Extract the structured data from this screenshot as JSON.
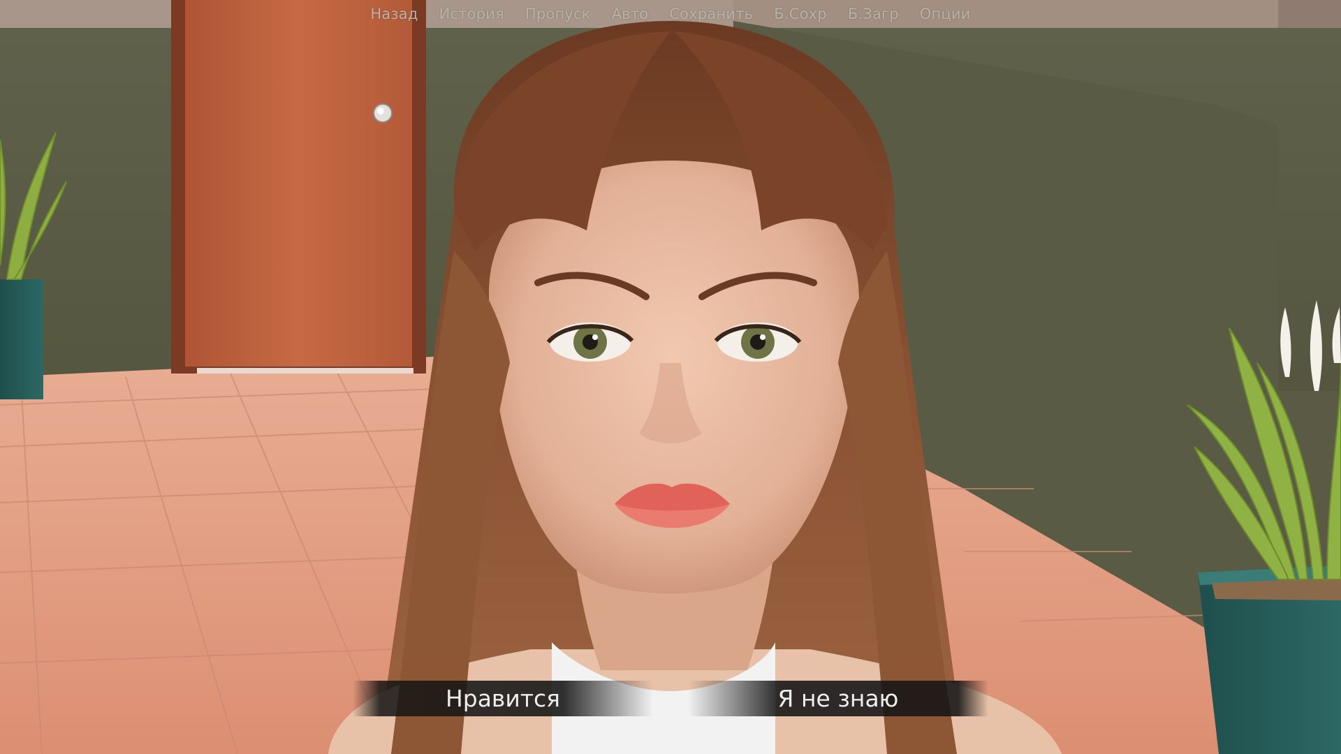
{
  "quick_menu": {
    "items": [
      "Назад",
      "История",
      "Пропуск",
      "Авто",
      "Сохранить",
      "Б.Сохр",
      "Б.Загр",
      "Опции"
    ]
  },
  "choices": {
    "items": [
      "Нравится",
      "Я не знаю"
    ]
  },
  "colors": {
    "menu_text": "#b9b3a9",
    "choice_text": "#eeeeee",
    "choice_bg": "#141414",
    "wall": "#5b5c45",
    "floor": "#e3a085",
    "door": "#b95e3c"
  },
  "icons": {
    "door_knob": "door-knob-icon"
  }
}
